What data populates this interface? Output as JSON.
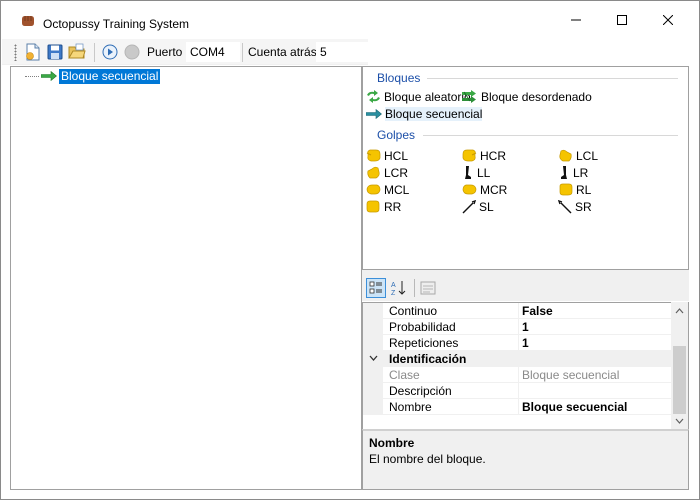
{
  "window": {
    "title": "Octopussy Training System"
  },
  "toolbar": {
    "port_label": "Puerto",
    "port_value": "COM4",
    "countdown_label": "Cuenta atrás",
    "countdown_value": "5"
  },
  "tree": {
    "root_label": "Bloque secuencial"
  },
  "palette": {
    "blocks_title": "Bloques",
    "blocks": [
      {
        "label": "Bloque aleatorio",
        "icon": "random-block-icon"
      },
      {
        "label": "Bloque desordenado",
        "icon": "shuffle-block-icon"
      },
      {
        "label": "Bloque secuencial",
        "icon": "sequential-block-icon"
      }
    ],
    "hits_title": "Golpes",
    "hits": [
      {
        "label": "HCL",
        "icon": "fist-icon"
      },
      {
        "label": "HCR",
        "icon": "fist-icon"
      },
      {
        "label": "LCL",
        "icon": "fist-icon"
      },
      {
        "label": "LCR",
        "icon": "fist-icon"
      },
      {
        "label": "LL",
        "icon": "leg-icon"
      },
      {
        "label": "LR",
        "icon": "leg-icon"
      },
      {
        "label": "MCL",
        "icon": "fist-icon"
      },
      {
        "label": "MCR",
        "icon": "fist-icon"
      },
      {
        "label": "RL",
        "icon": "fist-icon"
      },
      {
        "label": "RR",
        "icon": "fist-icon"
      },
      {
        "label": "SL",
        "icon": "stick-icon"
      },
      {
        "label": "SR",
        "icon": "stick-icon"
      }
    ]
  },
  "properties": {
    "rows": [
      {
        "name": "Continuo",
        "value": "False"
      },
      {
        "name": "Probabilidad",
        "value": "1"
      },
      {
        "name": "Repeticiones",
        "value": "1"
      }
    ],
    "category": "Identificación",
    "id_rows": [
      {
        "name": "Clase",
        "value": "Bloque secuencial"
      },
      {
        "name": "Descripción",
        "value": ""
      },
      {
        "name": "Nombre",
        "value": "Bloque secuencial"
      }
    ],
    "help_title": "Nombre",
    "help_desc": "El nombre del bloque."
  },
  "colors": {
    "selection": "#0078d7",
    "section_title": "#1c4fa8",
    "fist": "#f5c400",
    "arrow_green": "#3aa845"
  }
}
